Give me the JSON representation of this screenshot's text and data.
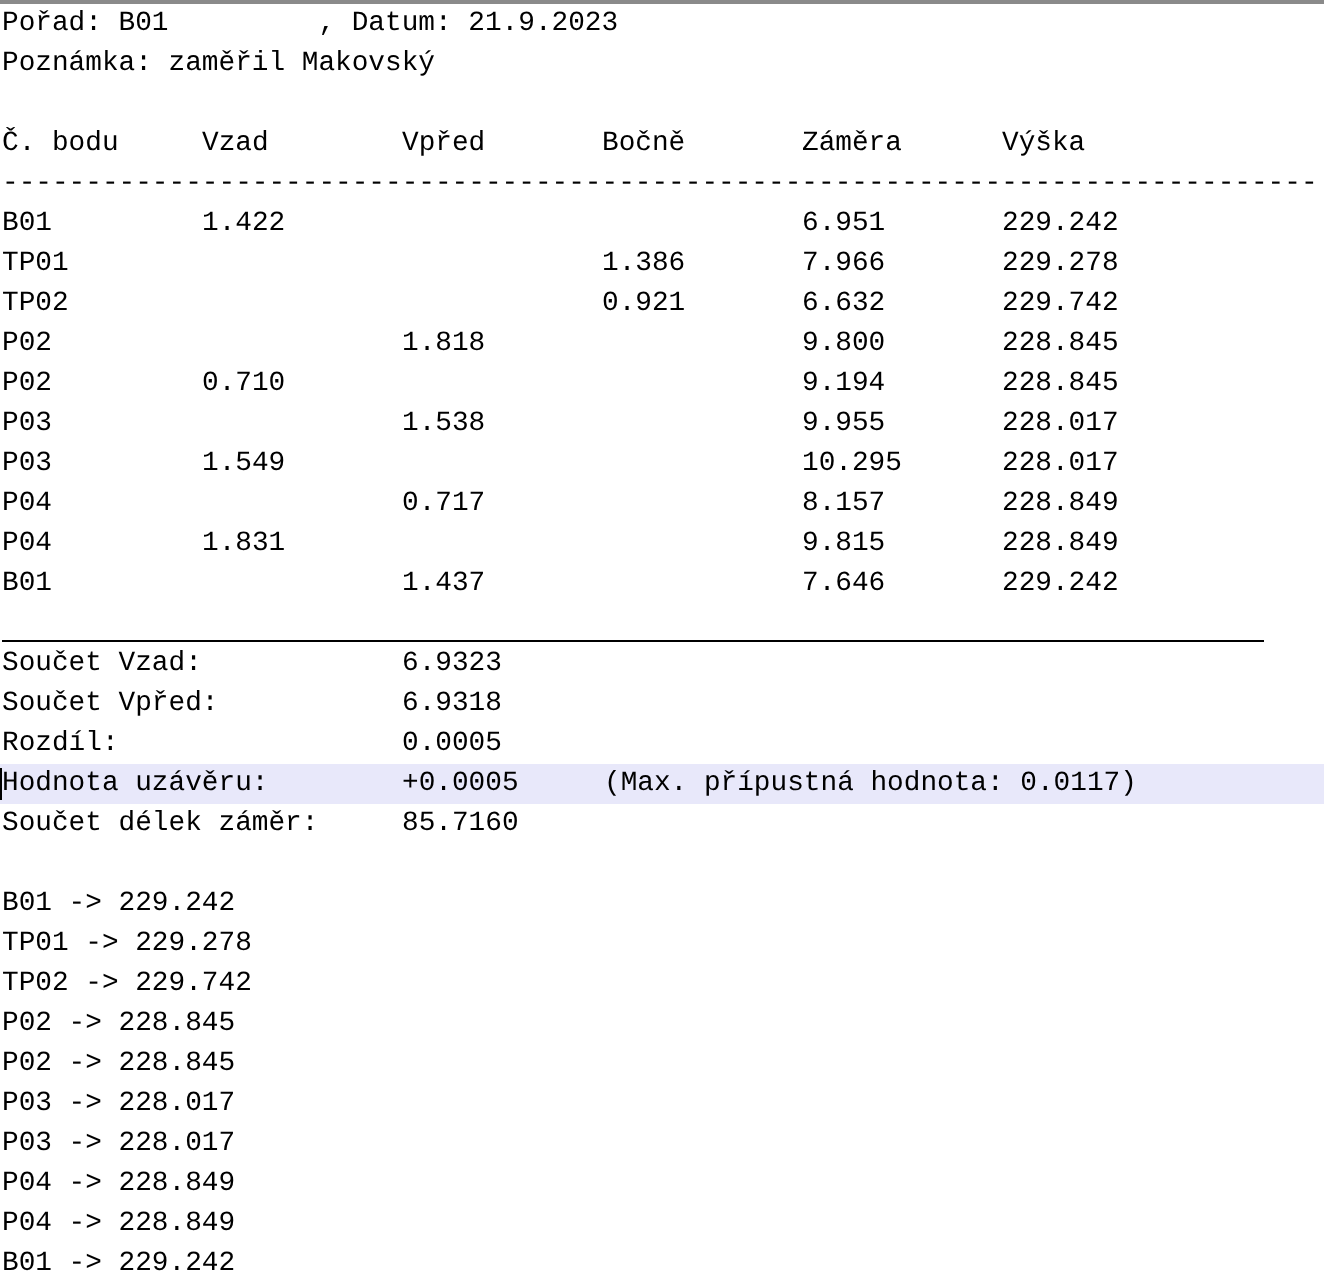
{
  "header_lines": [
    "Pořad: B01         , Datum: 21.9.2023",
    "Poznámka: zaměřil Makovský"
  ],
  "table": {
    "columns": [
      "Č. bodu",
      "Vzad",
      "Vpřed",
      "Bočně",
      "Záměra",
      "Výška"
    ],
    "separator": "-------------------------------------------------------------------------------",
    "rows": [
      [
        "B01",
        "1.422",
        "",
        "",
        "6.951",
        "229.242"
      ],
      [
        "TP01",
        "",
        "",
        "1.386",
        "7.966",
        "229.278"
      ],
      [
        "TP02",
        "",
        "",
        "0.921",
        "6.632",
        "229.742"
      ],
      [
        "P02",
        "",
        "1.818",
        "",
        "9.800",
        "228.845"
      ],
      [
        "P02",
        "0.710",
        "",
        "",
        "9.194",
        "228.845"
      ],
      [
        "P03",
        "",
        "1.538",
        "",
        "9.955",
        "228.017"
      ],
      [
        "P03",
        "1.549",
        "",
        "",
        "10.295",
        "228.017"
      ],
      [
        "P04",
        "",
        "0.717",
        "",
        "8.157",
        "228.849"
      ],
      [
        "P04",
        "1.831",
        "",
        "",
        "9.815",
        "228.849"
      ],
      [
        "B01",
        "",
        "1.437",
        "",
        "7.646",
        "229.242"
      ]
    ]
  },
  "summary": [
    {
      "label": "Součet Vzad:",
      "value": "6.9323",
      "current_line": false
    },
    {
      "label": "Součet Vpřed:",
      "value": "6.9318",
      "current_line": false
    },
    {
      "label": "Rozdíl:",
      "value": "0.0005",
      "current_line": false
    },
    {
      "label": "Hodnota uzávěru:",
      "value": "+0.0005",
      "note": "(Max. přípustná hodnota: 0.0117)",
      "current_line": true
    },
    {
      "label": "Součet délek záměr:",
      "value": "85.7160",
      "current_line": false
    }
  ],
  "results": [
    "B01 -> 229.242",
    "TP01 -> 229.278",
    "TP02 -> 229.742",
    "P02 -> 228.845",
    "P02 -> 228.845",
    "P03 -> 228.017",
    "P03 -> 228.017",
    "P04 -> 228.849",
    "P04 -> 228.849",
    "B01 -> 229.242"
  ]
}
